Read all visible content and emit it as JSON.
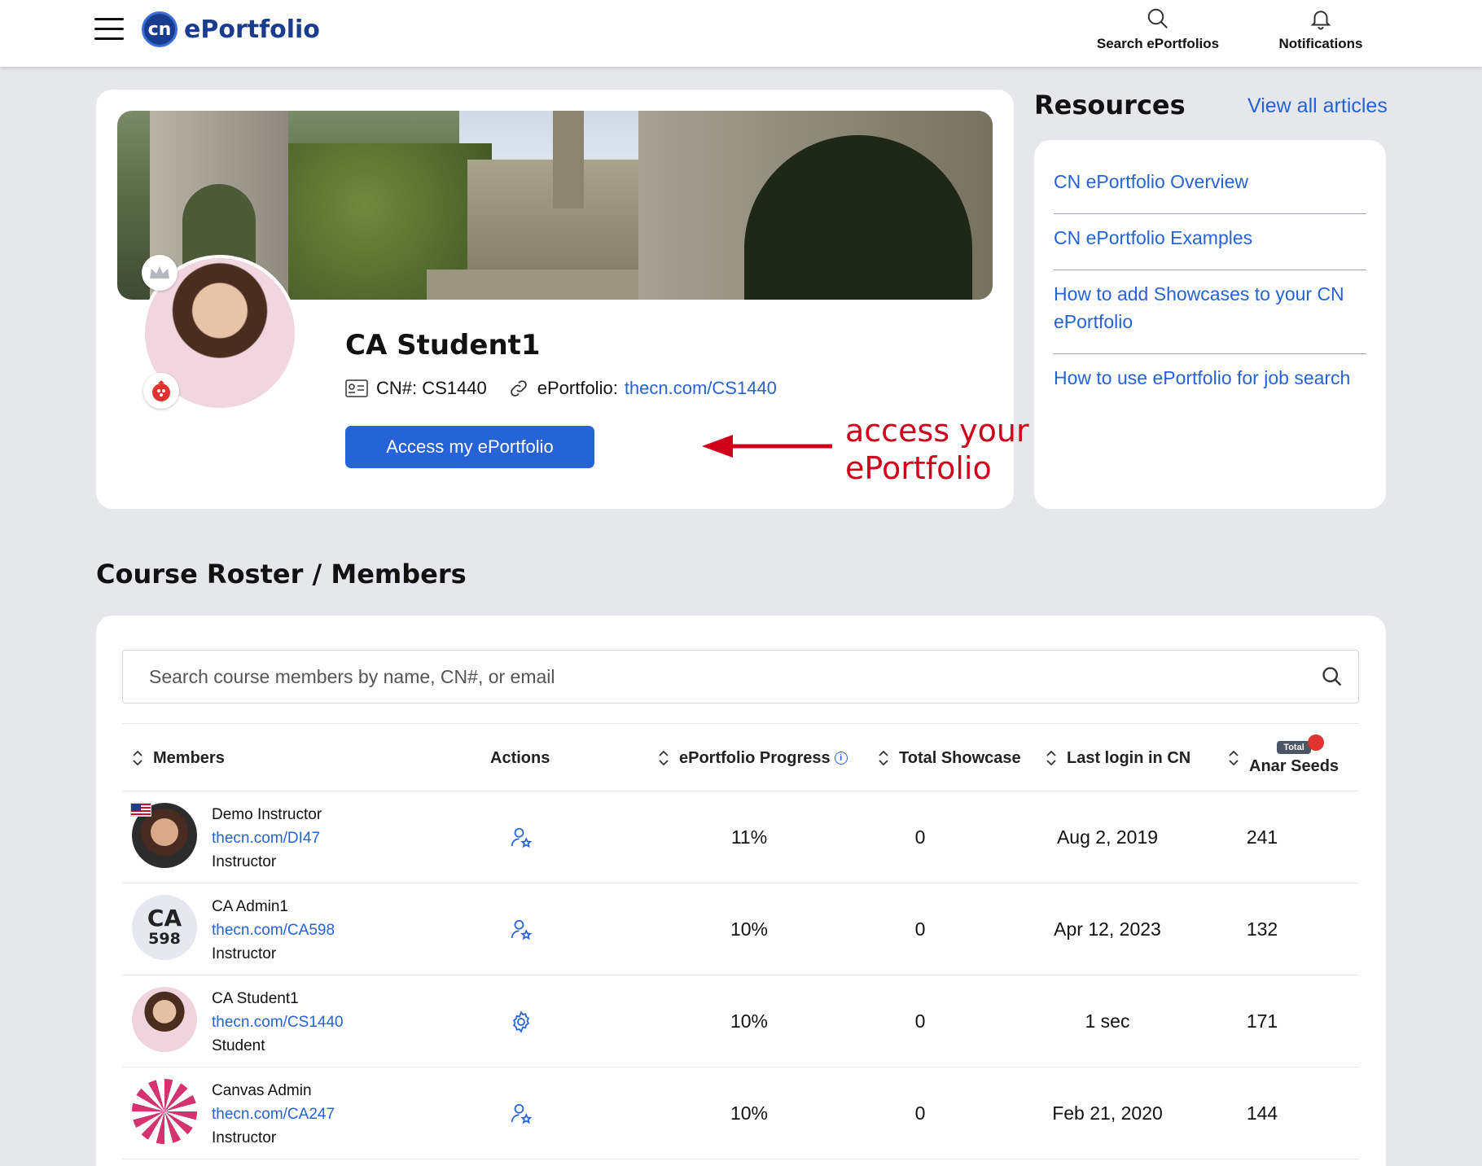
{
  "header": {
    "logo_badge": "cn",
    "logo_text": "ePortfolio",
    "search_label": "Search ePortfolios",
    "notifications_label": "Notifications"
  },
  "profile": {
    "name": "CA Student1",
    "cn_label": "CN#: CS1440",
    "eportfolio_label": "ePortfolio:",
    "eportfolio_link": "thecn.com/CS1440",
    "access_button": "Access my ePortfolio",
    "annotation": "access your ePortfolio",
    "annotation_color": "#d0021b"
  },
  "resources": {
    "title": "Resources",
    "view_all": "View all articles",
    "items": [
      "CN ePortfolio Overview",
      "CN ePortfolio Examples",
      "How to add Showcases to your CN ePortfolio",
      "How to use ePortfolio for job search"
    ]
  },
  "roster": {
    "title": "Course Roster / Members",
    "search_placeholder": "Search course members by name, CN#, or email",
    "columns": {
      "members": "Members",
      "actions": "Actions",
      "progress": "ePortfolio Progress",
      "showcase": "Total Showcase",
      "login": "Last login in CN",
      "seeds_pill": "Total",
      "seeds": "Anar Seeds"
    },
    "rows": [
      {
        "name": "Demo Instructor",
        "link": "thecn.com/DI47",
        "role": "Instructor",
        "action_icon": "user-star-icon",
        "progress": "11%",
        "showcase": "0",
        "login": "Aug 2, 2019",
        "seeds": "241"
      },
      {
        "name": "CA Admin1",
        "link": "thecn.com/CA598",
        "role": "Instructor",
        "avatar_line1": "CA",
        "avatar_line2": "598",
        "action_icon": "user-star-icon",
        "progress": "10%",
        "showcase": "0",
        "login": "Apr 12, 2023",
        "seeds": "132"
      },
      {
        "name": "CA Student1",
        "link": "thecn.com/CS1440",
        "role": "Student",
        "action_icon": "gear-icon",
        "progress": "10%",
        "showcase": "0",
        "login": "1 sec",
        "seeds": "171"
      },
      {
        "name": "Canvas Admin",
        "link": "thecn.com/CA247",
        "role": "Instructor",
        "action_icon": "user-star-icon",
        "progress": "10%",
        "showcase": "0",
        "login": "Feb 21, 2020",
        "seeds": "144"
      }
    ]
  },
  "colors": {
    "accent": "#2563d6",
    "brand": "#1a3c8e",
    "background": "#e5e7eb"
  }
}
